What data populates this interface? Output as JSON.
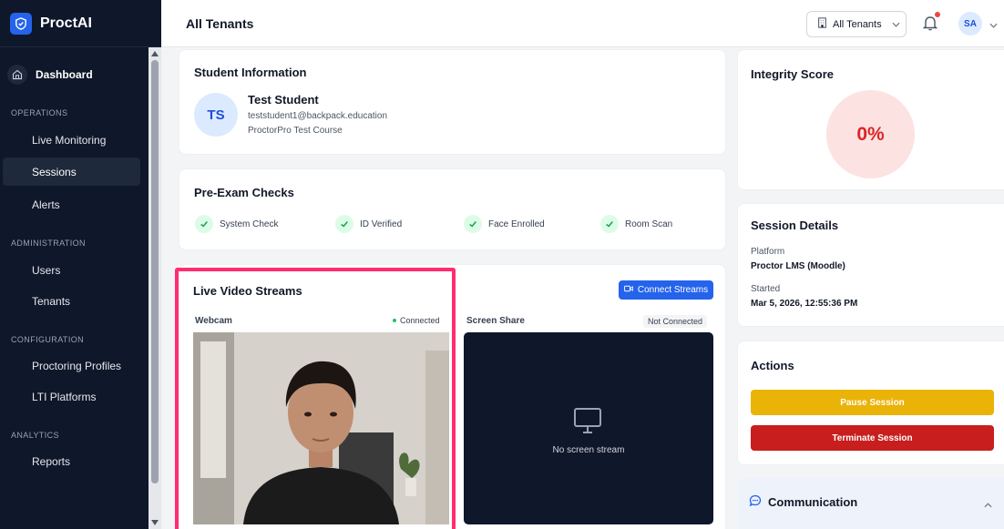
{
  "app": {
    "name": "ProctAI"
  },
  "sidebar": {
    "dashboard": "Dashboard",
    "sections": [
      {
        "label": "OPERATIONS"
      },
      {
        "label": "ADMINISTRATION"
      },
      {
        "label": "CONFIGURATION"
      },
      {
        "label": "ANALYTICS"
      }
    ],
    "items": [
      {
        "label": "Live Monitoring"
      },
      {
        "label": "Sessions",
        "active": true
      },
      {
        "label": "Alerts"
      },
      {
        "label": "Users"
      },
      {
        "label": "Tenants"
      },
      {
        "label": "Proctoring Profiles"
      },
      {
        "label": "LTI Platforms"
      },
      {
        "label": "Reports"
      }
    ]
  },
  "header": {
    "title": "All Tenants",
    "tenant_select": "All Tenants",
    "avatar": "SA"
  },
  "student": {
    "heading": "Student Information",
    "initials": "TS",
    "name": "Test Student",
    "email": "teststudent1@backpack.education",
    "course": "ProctorPro Test Course"
  },
  "checks": {
    "heading": "Pre-Exam Checks",
    "items": [
      {
        "label": "System Check"
      },
      {
        "label": "ID Verified"
      },
      {
        "label": "Face Enrolled"
      },
      {
        "label": "Room Scan"
      }
    ]
  },
  "streams": {
    "heading": "Live Video Streams",
    "connect_label": "Connect Streams",
    "webcam": {
      "label": "Webcam",
      "status": "Connected"
    },
    "screen": {
      "label": "Screen Share",
      "status": "Not Connected",
      "empty": "No screen stream"
    }
  },
  "integrity": {
    "heading": "Integrity Score",
    "value": "0%"
  },
  "session": {
    "heading": "Session Details",
    "platform_label": "Platform",
    "platform": "Proctor LMS (Moodle)",
    "started_label": "Started",
    "started": "Mar 5, 2026, 12:55:36 PM"
  },
  "actions": {
    "heading": "Actions",
    "pause": "Pause Session",
    "terminate": "Terminate Session"
  },
  "communication": {
    "heading": "Communication"
  },
  "colors": {
    "accent": "#2563eb",
    "pause": "#eab308",
    "terminate": "#c81e1e",
    "highlight": "#ff2d6f",
    "sidebar": "#0f172a"
  }
}
